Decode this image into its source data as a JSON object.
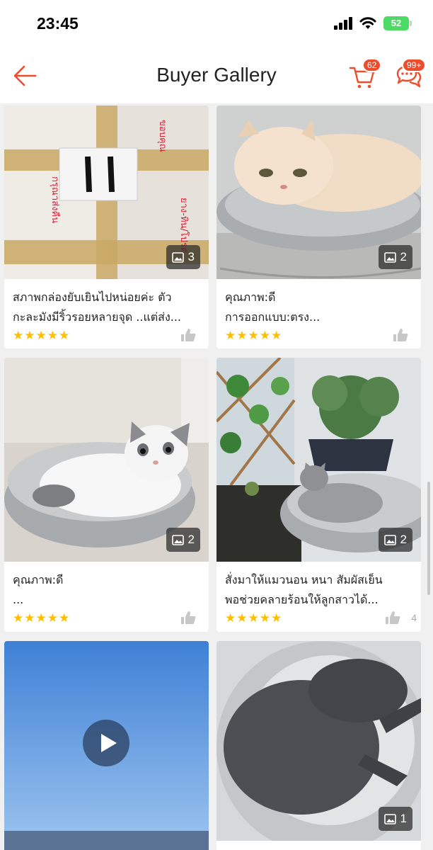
{
  "status_bar": {
    "time": "23:45",
    "battery": "52"
  },
  "header": {
    "title": "Buyer Gallery",
    "cart_badge": "62",
    "chat_badge": "99+"
  },
  "colors": {
    "accent": "#ee4d2d",
    "star": "#ffbf00",
    "battery": "#4cd964"
  },
  "icons": {
    "back": "arrow-left-icon",
    "cart": "cart-icon",
    "chat": "chat-bubbles-icon",
    "photo": "image-icon",
    "like": "thumbs-up-icon",
    "play": "play-icon"
  },
  "cards": [
    {
      "photo_count": "3",
      "caption_line1": "สภาพกล่องยับเยินไปหน่อยค่ะ  ตัว",
      "caption_line2": "กะละมังมีริ้วรอยหลายจุด ..แต่ส่ง...",
      "rating": 5,
      "likes": ""
    },
    {
      "photo_count": "2",
      "caption_line1": "คุณภาพ:ดี",
      "caption_line2": "การออกแบบ:ตรง...",
      "rating": 5,
      "likes": ""
    },
    {
      "photo_count": "2",
      "caption_line1": "คุณภาพ:ดี",
      "caption_line2": "...",
      "rating": 5,
      "likes": ""
    },
    {
      "photo_count": "2",
      "caption_line1": "สั่งมาให้แมวนอน หนา สัมผัสเย็น",
      "caption_line2": "พอช่วยคลายร้อนให้ลูกสาวได้...",
      "rating": 5,
      "likes": "4"
    },
    {
      "photo_count": "",
      "is_video": true
    },
    {
      "photo_count": "1"
    }
  ]
}
